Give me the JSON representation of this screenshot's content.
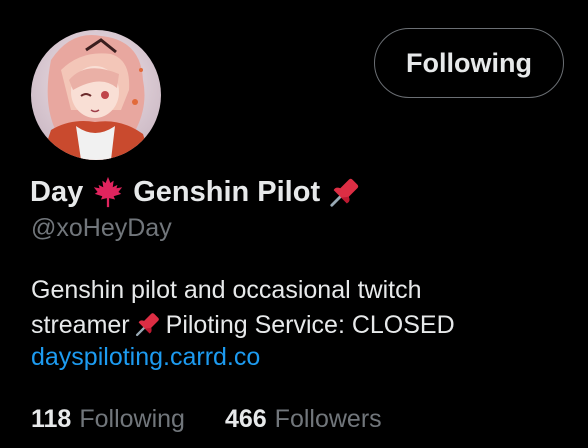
{
  "profile": {
    "follow_button_label": "Following",
    "display_name_part1": "Day",
    "display_name_part2": "Genshin Pilot",
    "handle": "@xoHeyDay",
    "bio_line1": "Genshin pilot and occasional twitch",
    "bio_line2_a": "streamer",
    "bio_line2_b": "Piloting Service: CLOSED",
    "website": "dayspiloting.carrd.co",
    "following_count": "118",
    "following_label": "Following",
    "followers_count": "466",
    "followers_label": "Followers",
    "name_icons": [
      "maple-leaf-icon",
      "pushpin-icon"
    ],
    "bio_icons": [
      "pushpin-icon"
    ]
  },
  "colors": {
    "background": "#000000",
    "primary_text": "#e7e9ea",
    "secondary_text": "#71767b",
    "link": "#1d9bf0",
    "button_border": "#6b6f74",
    "maple_leaf": "#e0245e",
    "pushpin": "#dd2e44"
  }
}
